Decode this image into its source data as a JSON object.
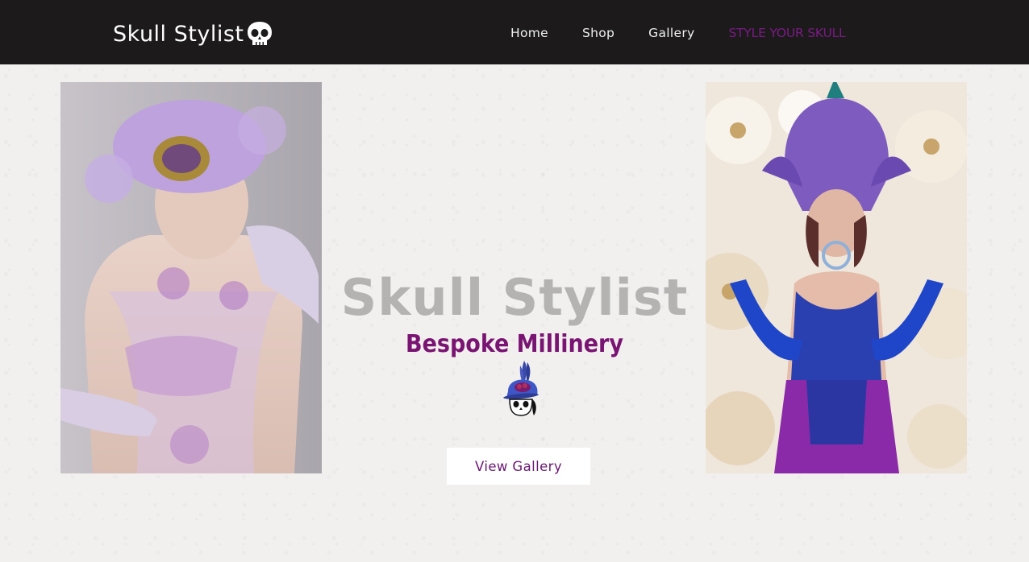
{
  "header": {
    "brand": "Skull Stylist",
    "brand_icon": "skull-icon",
    "nav": [
      {
        "label": "Home"
      },
      {
        "label": "Shop"
      },
      {
        "label": "Gallery"
      },
      {
        "label": "STYLE YOUR SKULL"
      }
    ]
  },
  "hero": {
    "title": "Skull Stylist",
    "subtitle": "Bespoke Millinery",
    "logo_icon": "skull-with-feathered-hat-icon",
    "cta_label": "View Gallery"
  },
  "colors": {
    "header_bg": "#1c1a1a",
    "accent_purple": "#7a1b86",
    "subtitle_purple": "#7a1472",
    "title_gray": "#b4b3b2",
    "page_bg": "#f1f0ef"
  }
}
